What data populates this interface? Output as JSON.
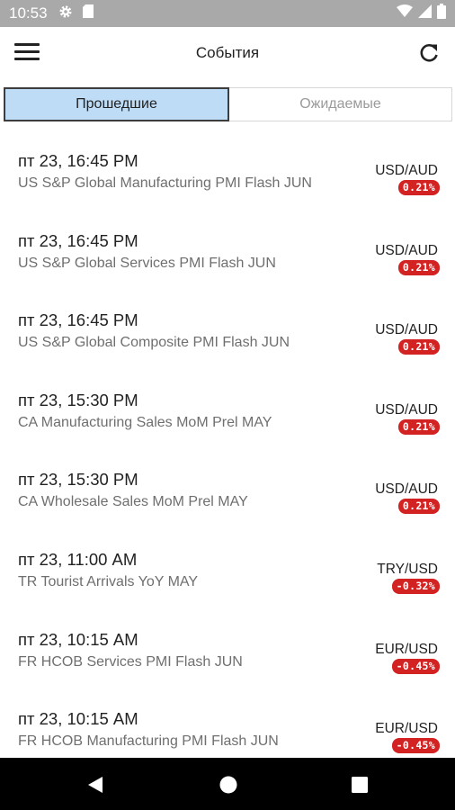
{
  "status_bar": {
    "time": "10:53"
  },
  "header": {
    "title": "События"
  },
  "tabs": [
    {
      "label": "Прошедшие",
      "active": true
    },
    {
      "label": "Ожидаемые",
      "active": false
    }
  ],
  "events": [
    {
      "time": "пт 23, 16:45 PM",
      "name": "US S&P Global Manufacturing PMI Flash JUN",
      "pair": "USD/AUD",
      "change": "0.21%"
    },
    {
      "time": "пт 23, 16:45 PM",
      "name": "US S&P Global Services PMI Flash JUN",
      "pair": "USD/AUD",
      "change": "0.21%"
    },
    {
      "time": "пт 23, 16:45 PM",
      "name": "US S&P Global Composite PMI Flash JUN",
      "pair": "USD/AUD",
      "change": "0.21%"
    },
    {
      "time": "пт 23, 15:30 PM",
      "name": "CA Manufacturing Sales MoM Prel MAY",
      "pair": "USD/AUD",
      "change": "0.21%"
    },
    {
      "time": "пт 23, 15:30 PM",
      "name": "CA Wholesale Sales MoM Prel MAY",
      "pair": "USD/AUD",
      "change": "0.21%"
    },
    {
      "time": "пт 23, 11:00 AM",
      "name": "TR Tourist Arrivals YoY MAY",
      "pair": "TRY/USD",
      "change": "-0.32%"
    },
    {
      "time": "пт 23, 10:15 AM",
      "name": "FR HCOB Services PMI Flash JUN",
      "pair": "EUR/USD",
      "change": "-0.45%"
    },
    {
      "time": "пт 23, 10:15 AM",
      "name": "FR HCOB Manufacturing PMI Flash JUN",
      "pair": "EUR/USD",
      "change": "-0.45%"
    }
  ],
  "colors": {
    "tab_active_bg": "#bfdcf7",
    "badge_red": "#d32222",
    "status_bar": "#a9a9a9"
  }
}
